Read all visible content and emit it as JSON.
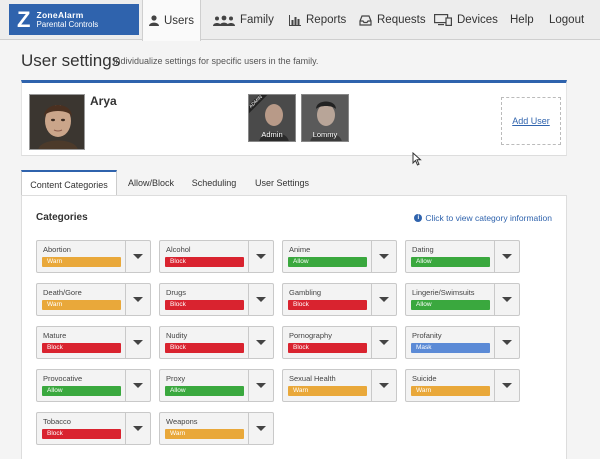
{
  "brand": {
    "line1": "ZoneAlarm",
    "line2": "Parental Controls",
    "letter": "Z",
    "color": "#2f63ad"
  },
  "nav": {
    "users": "Users",
    "family": "Family",
    "reports": "Reports",
    "requests": "Requests",
    "devices": "Devices",
    "help": "Help",
    "logout": "Logout"
  },
  "header": {
    "title": "User settings",
    "subtitle": "Individualize settings for specific users in the family."
  },
  "profile": {
    "name": "Arya",
    "members": [
      {
        "label": "Admin",
        "ribbon": "ADMIN"
      },
      {
        "label": "Lommy"
      }
    ],
    "add_user": "Add User"
  },
  "tabs": [
    "Content Categories",
    "Allow/Block",
    "Scheduling",
    "User Settings"
  ],
  "categories": {
    "heading": "Categories",
    "info_link": "Click to view category information",
    "status_colors": {
      "Warn": "#e9a83a",
      "Block": "#d9232f",
      "Allow": "#3aa83e",
      "Mask": "#5b8ad6"
    },
    "items": [
      {
        "name": "Abortion",
        "status": "Warn"
      },
      {
        "name": "Alcohol",
        "status": "Block"
      },
      {
        "name": "Anime",
        "status": "Allow"
      },
      {
        "name": "Dating",
        "status": "Allow"
      },
      {
        "name": "Death/Gore",
        "status": "Warn"
      },
      {
        "name": "Drugs",
        "status": "Block"
      },
      {
        "name": "Gambling",
        "status": "Block"
      },
      {
        "name": "Lingerie/Swimsuits",
        "status": "Allow"
      },
      {
        "name": "Mature",
        "status": "Block"
      },
      {
        "name": "Nudity",
        "status": "Block"
      },
      {
        "name": "Pornography",
        "status": "Block"
      },
      {
        "name": "Profanity",
        "status": "Mask"
      },
      {
        "name": "Provocative",
        "status": "Allow"
      },
      {
        "name": "Proxy",
        "status": "Allow"
      },
      {
        "name": "Sexual Health",
        "status": "Warn"
      },
      {
        "name": "Suicide",
        "status": "Warn"
      },
      {
        "name": "Tobacco",
        "status": "Block"
      },
      {
        "name": "Weapons",
        "status": "Warn"
      }
    ]
  }
}
